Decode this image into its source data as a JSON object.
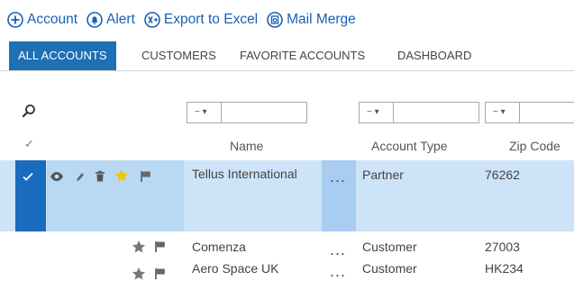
{
  "toolbar": {
    "account_label": "Account",
    "alert_label": "Alert",
    "export_label": "Export to Excel",
    "mail_merge_label": "Mail Merge"
  },
  "tabs": [
    {
      "label": "ALL ACCOUNTS",
      "active": true
    },
    {
      "label": "CUSTOMERS",
      "active": false
    },
    {
      "label": "FAVORITE ACCOUNTS",
      "active": false
    },
    {
      "label": "DASHBOARD",
      "active": false
    }
  ],
  "filters": {
    "operator": "~ ▾"
  },
  "columns": {
    "check_symbol": "✓",
    "name": "Name",
    "account_type": "Account Type",
    "zip_code": "Zip Code"
  },
  "rows": [
    {
      "name": "Tellus International",
      "more": "...",
      "account_type": "Partner",
      "zip": "76262",
      "selected": true,
      "favorite": true
    },
    {
      "name": "Comenza",
      "more": "...",
      "account_type": "Customer",
      "zip": "27003",
      "selected": false,
      "favorite": false
    },
    {
      "name": "Aero Space UK",
      "more": "...",
      "account_type": "Customer",
      "zip": "HK234",
      "selected": false,
      "favorite": false
    }
  ],
  "colors": {
    "link": "#1a5fb4",
    "tab_active": "#1f6fb5",
    "row_selected": "#cde3f7",
    "favorite_star": "#f5c400",
    "default_star": "#777777"
  }
}
